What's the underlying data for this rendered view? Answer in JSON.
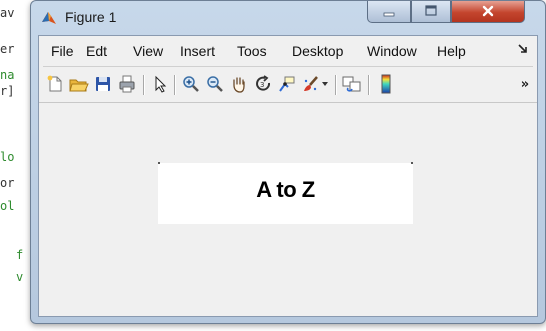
{
  "background_code": {
    "lines": [
      "av",
      "er",
      "na",
      "r]",
      "lo",
      "or",
      "ol",
      "f",
      "v"
    ],
    "colors": {
      "default": "#222222",
      "comment": "#228b22"
    }
  },
  "window": {
    "title": "Figure 1",
    "icon": "matlab-logo-icon",
    "controls": {
      "minimize": "minimize-icon",
      "maximize": "maximize-icon",
      "close": "close-icon"
    }
  },
  "menubar": {
    "items": [
      "File",
      "Edt",
      "View",
      "Insert",
      "Toos",
      "Desktop",
      "Window",
      "Help"
    ],
    "overflow_icon": "dock-arrow-icon"
  },
  "toolbar": {
    "icons": [
      "new-figure-icon",
      "open-file-icon",
      "save-icon",
      "print-icon",
      "edit-plot-icon",
      "zoom-in-icon",
      "zoom-out-icon",
      "pan-icon",
      "rotate-3d-icon",
      "data-cursor-icon",
      "brush-icon",
      "brush-dropdown-icon",
      "link-plot-icon",
      "insert-colorbar-icon"
    ],
    "overflow": "»"
  },
  "axes": {
    "title": "A to Z"
  }
}
